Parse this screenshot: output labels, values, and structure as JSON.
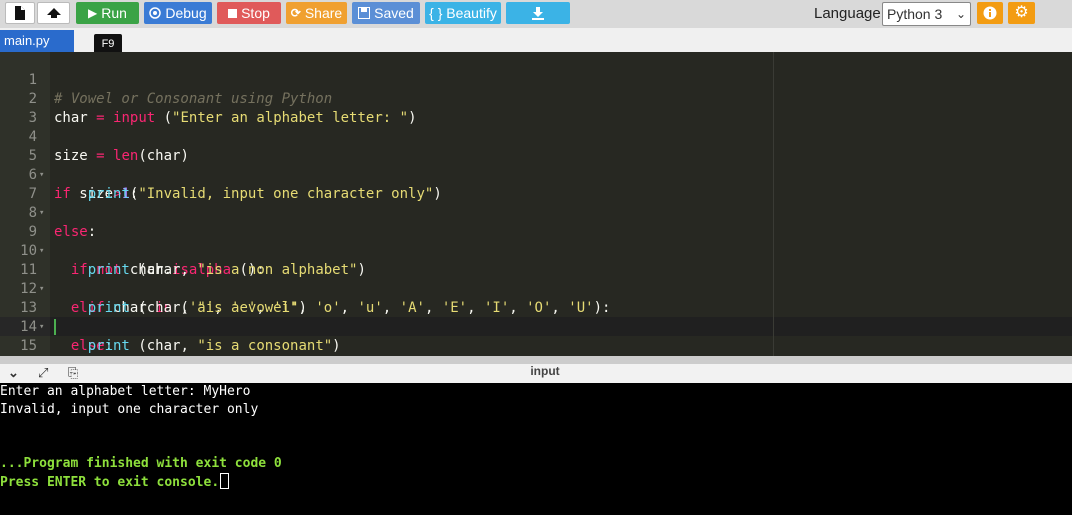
{
  "toolbar": {
    "run_label": "Run",
    "debug_label": "Debug",
    "stop_label": "Stop",
    "share_label": "Share",
    "saved_label": "Saved",
    "beautify_label": "{ } Beautify",
    "language_label": "Language",
    "language_value": "Python 3"
  },
  "tabs": {
    "file_name": "main.py",
    "tooltip": "F9"
  },
  "editor": {
    "line_numbers": [
      "1",
      "2",
      "3",
      "4",
      "5",
      "6",
      "7",
      "8",
      "9",
      "10",
      "11",
      "12",
      "13",
      "14",
      "15"
    ],
    "fold_markers": [
      "",
      "",
      "",
      "",
      "▾",
      "",
      "▾",
      "",
      "▾",
      "",
      "▾",
      "",
      "▾",
      "",
      ""
    ]
  },
  "console": {
    "title": "input",
    "lines": [
      "Enter an alphabet letter: MyHero",
      "Invalid, input one character only",
      "...Program finished with exit code 0",
      "Press ENTER to exit console."
    ]
  },
  "colors": {
    "run": "#3aa346",
    "debug": "#3a7bd5",
    "stop": "#e05a5a",
    "share": "#f0a030",
    "saved": "#5b8fd6",
    "beautify": "#3bb3e6",
    "download": "#3bb3e6",
    "info": "#f39c12",
    "settings": "#f39c12"
  },
  "icons": {
    "new_file": "new-file-icon",
    "upload": "upload-icon",
    "run": "play-icon",
    "debug": "bug-icon",
    "stop": "stop-icon",
    "share": "share-icon",
    "saved": "save-icon",
    "download": "download-icon",
    "info": "info-icon",
    "settings": "gear-icon"
  }
}
